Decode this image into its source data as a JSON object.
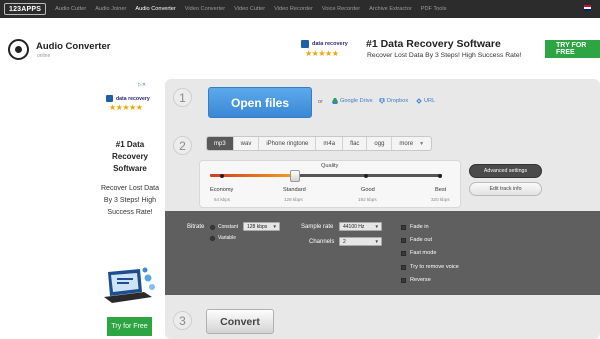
{
  "nav": {
    "brand": "123APPS",
    "items": [
      "Audio Cutter",
      "Audio Joiner",
      "Audio Converter",
      "Video Converter",
      "Video Cutter",
      "Video Recorder",
      "Voice Recorder",
      "Archive Extractor",
      "PDF Tools"
    ],
    "active": "Audio Converter"
  },
  "header": {
    "title": "Audio Converter",
    "subtitle": "online"
  },
  "ad_top": {
    "brand": "data recovery",
    "stars": "★★★★★",
    "title": "#1 Data Recovery Software",
    "text": "Recover Lost Data By 3 Steps!  High Success Rate!",
    "button": "TRY FOR FREE"
  },
  "ad_side": {
    "adchoices": "▷✕",
    "brand": "data recovery",
    "stars": "★★★★★",
    "title": "#1 Data Recovery Software",
    "text": "Recover Lost Data By 3 Steps! High Success Rate!",
    "button": "Try for Free"
  },
  "step1": {
    "number": "1",
    "open_label": "Open files",
    "or": "or",
    "links": [
      "Google Drive",
      "Dropbox",
      "URL"
    ]
  },
  "step2": {
    "number": "2",
    "formats": [
      "mp3",
      "wav",
      "iPhone ringtone",
      "m4a",
      "flac",
      "ogg",
      "more"
    ],
    "selected_format": "mp3",
    "quality_label": "Quality",
    "quality_levels": [
      {
        "name": "Economy",
        "rate": "64 kbps"
      },
      {
        "name": "Standard",
        "rate": "128 kbps"
      },
      {
        "name": "Good",
        "rate": "192 kbps"
      },
      {
        "name": "Best",
        "rate": "320 kbps"
      }
    ],
    "selected_quality": "Standard",
    "advanced_button": "Advanced settings",
    "track_button": "Edit track info"
  },
  "advanced": {
    "bitrate_label": "Bitrate",
    "bitrate_modes": [
      "Constant",
      "Variable"
    ],
    "bitrate_value": "128 kbps",
    "sample_rate_label": "Sample rate",
    "sample_rate_value": "44100 Hz",
    "channels_label": "Channels",
    "channels_value": "2",
    "options": [
      "Fade in",
      "Fade out",
      "Fast mode",
      "Try to remove voice",
      "Reverse"
    ]
  },
  "step3": {
    "number": "3",
    "convert_label": "Convert"
  },
  "colors": {
    "nav_bg": "#2c2c2c",
    "open_button": "#4a9ae3",
    "cta_green": "#2ea543",
    "star": "#f4a400",
    "panel": "#e8e8e8",
    "advanced_bg": "#5f5f5f"
  }
}
